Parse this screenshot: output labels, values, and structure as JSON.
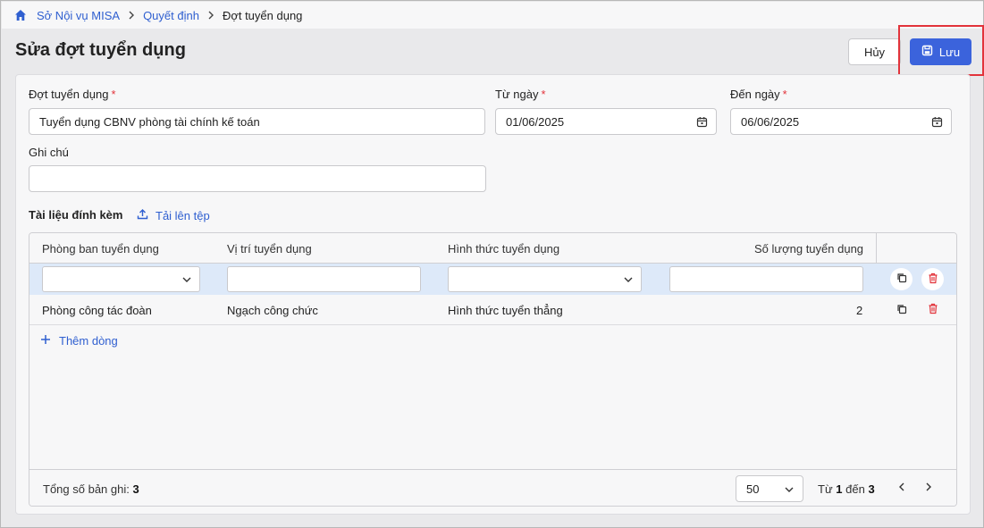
{
  "breadcrumb": {
    "items": [
      "Sở Nội vụ MISA",
      "Quyết định"
    ],
    "current": "Đợt tuyển dụng"
  },
  "page": {
    "title": "Sửa đợt tuyển dụng"
  },
  "actions": {
    "cancel_label": "Hủy",
    "save_label": "Lưu"
  },
  "form": {
    "recruitment_label": "Đợt tuyển dụng",
    "recruitment_value": "Tuyển dụng CBNV phòng tài chính kế toán",
    "from_label": "Từ ngày",
    "from_value": "01/06/2025",
    "to_label": "Đến ngày",
    "to_value": "06/06/2025",
    "note_label": "Ghi chú",
    "note_value": "",
    "required_mark": "*"
  },
  "attachments": {
    "title": "Tài liệu đính kèm",
    "upload_label": "Tải lên tệp"
  },
  "grid": {
    "columns": [
      "Phòng ban tuyển dụng",
      "Vị trí tuyển dụng",
      "Hình thức tuyển dụng",
      "Số lượng tuyển dụng"
    ],
    "rows": [
      {
        "department": "Phòng công tác đoàn",
        "position": "Ngạch công chức",
        "method": "Hình thức tuyển thẳng",
        "quantity": "2"
      }
    ],
    "add_row_label": "Thêm dòng"
  },
  "footer": {
    "total_label": "Tổng số bản ghi:",
    "total_value": "3",
    "page_size": "50",
    "range_from_label": "Từ",
    "range_from": "1",
    "range_to_label": "đến",
    "range_to": "3"
  },
  "colors": {
    "accent": "#3b63dc",
    "link": "#2f5fd0",
    "danger": "#e2333b",
    "edit_row": "#dde9f9"
  },
  "icons": [
    "home-icon",
    "chevron-right-icon",
    "save-icon",
    "calendar-icon",
    "upload-icon",
    "chevron-down-icon",
    "copy-icon",
    "trash-icon",
    "plus-icon",
    "chevron-left-icon"
  ]
}
